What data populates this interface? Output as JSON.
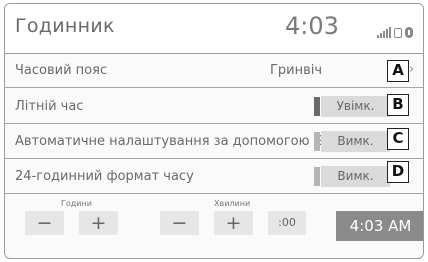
{
  "header": {
    "title": "Годинник",
    "clock": "4:03",
    "status_icons": [
      "signal-bars-icon",
      "phone-icon",
      "bluetooth-icon"
    ]
  },
  "rows": [
    {
      "label": "Часовий пояс",
      "value": "Гринвіч",
      "callout": "A"
    },
    {
      "label": "Літній час",
      "toggle": "Увімк.",
      "state": "on",
      "callout": "B"
    },
    {
      "label": "Автоматичне налаштування за допомогою GPS",
      "toggle": "Вимк.",
      "state": "off",
      "callout": "C"
    },
    {
      "label": "24-годинний формат часу",
      "toggle": "Вимк.",
      "state": "off",
      "callout": "D"
    }
  ],
  "adjust": {
    "hours_label": "Години",
    "minutes_label": "Хвилини",
    "minus": "−",
    "plus": "+",
    "zero_label": ":00",
    "time_display": "4:03 AM"
  },
  "colors": {
    "indicator_on": "#6a6a6a",
    "indicator_off": "#b5b5b5",
    "time_box": "#8a8a8a"
  }
}
